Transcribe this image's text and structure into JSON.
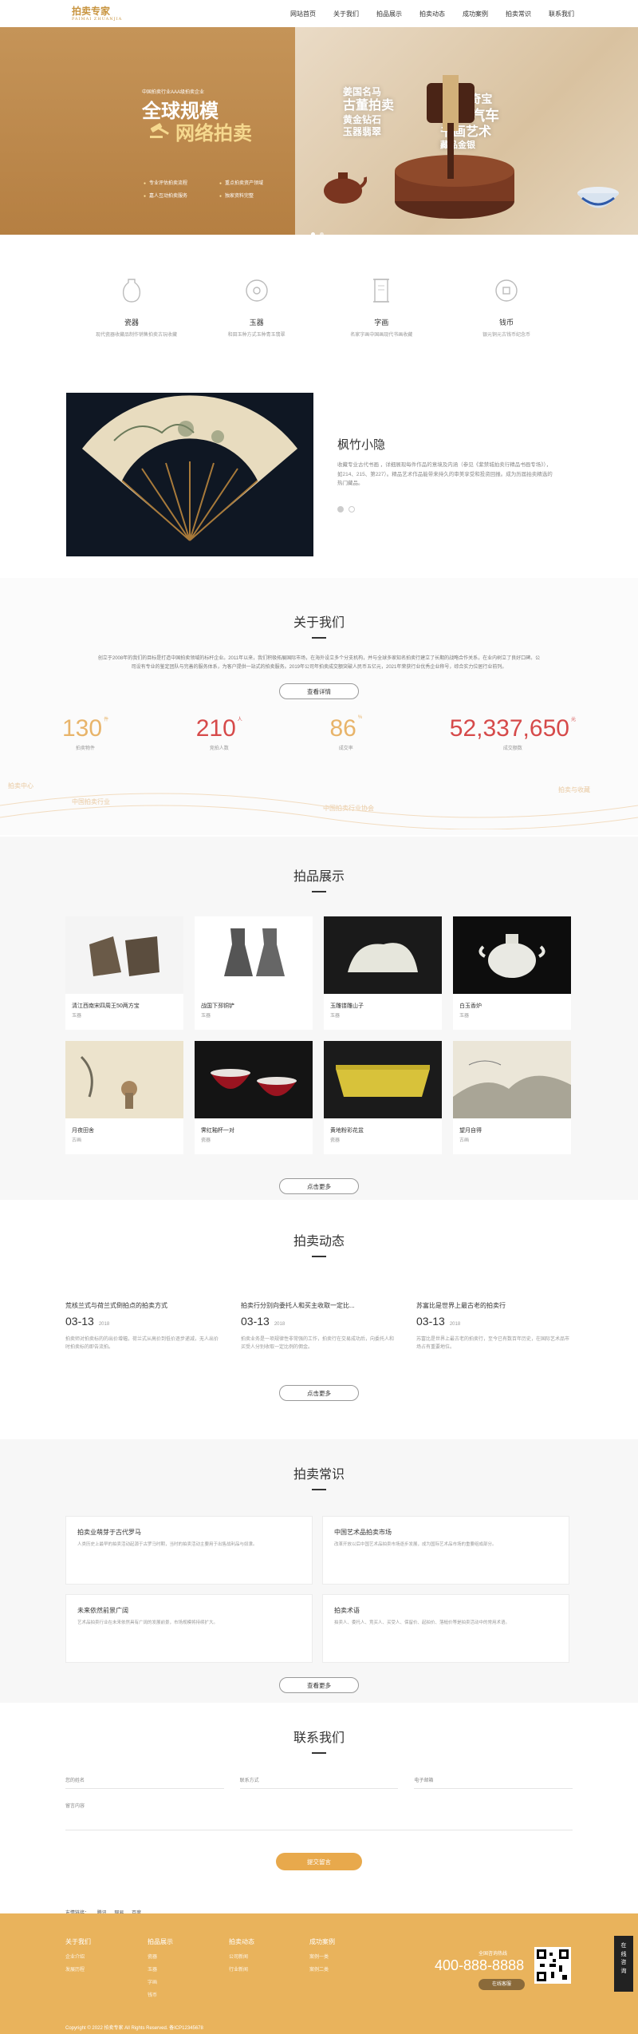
{
  "header": {
    "logo": "拍卖专家",
    "logo_sub": "PAIMAI ZHUANJIA",
    "nav": [
      "网站首页",
      "关于我们",
      "拍品展示",
      "拍卖动态",
      "成功案例",
      "拍卖常识",
      "联系我们"
    ]
  },
  "banner": {
    "subtitle": "中国拍卖行业AAA级拍卖企业",
    "title1": "全球规模",
    "title2": "网络拍卖",
    "features": [
      "专业评估拍卖流程",
      "重点拍卖资产领域",
      "嘉人互动拍卖服务",
      "独家资料完整",
      "拍卖热线电话"
    ],
    "promo_left": [
      "姜国名马",
      "古董拍卖",
      "黄金钻石",
      "玉器翡翠"
    ],
    "promo_right": [
      "100个奇宝",
      "50辆汽车",
      "书画艺术",
      "藏品金银"
    ]
  },
  "categories": [
    {
      "icon": "vase-icon",
      "title": "瓷器",
      "desc": "现代瓷器收藏品制作销售拍卖古玩收藏"
    },
    {
      "icon": "jade-disc-icon",
      "title": "玉器",
      "desc": "和田玉种方式玉种青玉翡翠"
    },
    {
      "icon": "scroll-icon",
      "title": "字画",
      "desc": "名家字画中国画现代书画收藏"
    },
    {
      "icon": "coin-icon",
      "title": "钱币",
      "desc": "银元铜元古钱币纪念币"
    }
  ],
  "feature": {
    "title": "枫竹小隐",
    "desc": "收藏专业古代书画 ，详细展现每件作品的意境及内涵（参见《紫禁城拍卖行精品书画专场》），如214、215、第227）。精品艺术作品能带来持久的审美享受和投资回报。成为历届拍卖精选的热门藏品。"
  },
  "about": {
    "title": "关于我们",
    "desc": "创立于2008年的我们的目标是打造中国拍卖领域的标杆企业。2011年以来，我们积极拓展国际市场，在海外设立多个分支机构，并与全球多家知名拍卖行建立了长期的战略合作关系，在业内树立了良好口碑。公司设有专业的鉴定团队与完善的服务体系，为客户提供一站式的拍卖服务。2019年公司年拍卖成交额突破人民币五亿元，2021年荣获行业优秀企业称号，综合实力位居行业前列。",
    "button": "查看详情",
    "stats": [
      {
        "value": "130",
        "unit": "件",
        "label": "拍卖物件",
        "color": "#e8b46a"
      },
      {
        "value": "210",
        "unit": "人",
        "label": "竞拍人数",
        "color": "#d64a4a"
      },
      {
        "value": "86",
        "unit": "%",
        "label": "成交率",
        "color": "#e8b46a"
      },
      {
        "value": "52,337,650",
        "unit": "元",
        "label": "成交额数",
        "color": "#d64a4a"
      }
    ],
    "watermarks": [
      "拍卖中心",
      "中国拍卖行业",
      "中国拍卖行业协会",
      "拍卖与收藏"
    ]
  },
  "products": {
    "title": "拍品展示",
    "items": [
      {
        "title": "清江西南宋四周王50两方宝",
        "cat": "玉器"
      },
      {
        "title": "战国下邳铜铲",
        "cat": "玉器"
      },
      {
        "title": "玉雕镂雕山子",
        "cat": "玉器"
      },
      {
        "title": "白玉香炉",
        "cat": "玉器"
      },
      {
        "title": "月夜田舍",
        "cat": "古画"
      },
      {
        "title": "霁红釉杯一对",
        "cat": "瓷器"
      },
      {
        "title": "黄地粉彩花盆",
        "cat": "瓷器"
      },
      {
        "title": "望月自得",
        "cat": "古画"
      }
    ],
    "button": "点击更多"
  },
  "news": {
    "title": "拍卖动态",
    "items": [
      {
        "title": "荒核兰式与荷兰式倒拍点的拍卖方式",
        "day": "03-13",
        "year": "2018",
        "summary": "拍卖师对拍卖标的的出价增幅，荷兰式从高价到低价逐步递减，无人出价时拍卖标的即告流拍。"
      },
      {
        "title": "拍卖行分别向委托人和买主收取一定比...",
        "day": "03-13",
        "year": "2018",
        "summary": "拍卖业务是一项规律性非常强的工作，拍卖行在交易成功后，向委托人和买受人分别收取一定比例的佣金。"
      },
      {
        "title": "苏富比是世界上最古老的拍卖行",
        "day": "03-13",
        "year": "2018",
        "summary": "苏富比是世界上最古老的拍卖行，至今已有数百年历史，在国际艺术品市场占有重要地位。"
      }
    ],
    "button": "点击更多"
  },
  "tips": {
    "title": "拍卖常识",
    "items": [
      {
        "title": "拍卖业萌芽于古代罗马",
        "summary": "人类历史上最早的拍卖活动起源于古罗马时期，当时的拍卖活动主要用于出售战利品与奴隶。"
      },
      {
        "title": "中国艺术品拍卖市场",
        "summary": "改革开放以后中国艺术品拍卖市场逐步发展，成为国际艺术品市场的重要组成部分。"
      },
      {
        "title": "未来依然前景广阔",
        "summary": "艺术品拍卖行业在未来依然具有广阔的发展前景，市场规模将持续扩大。"
      },
      {
        "title": "拍卖术语",
        "summary": "拍卖人、委托人、竞买人、买受人、保留价、起拍价、落槌价等是拍卖活动中的常用术语。"
      }
    ],
    "button": "查看更多"
  },
  "contact": {
    "title": "联系我们",
    "fields": [
      "您的姓名",
      "联系方式",
      "电子邮箱"
    ],
    "message": "留言内容",
    "submit": "提交留言",
    "links_label": "友情链接：",
    "links": [
      "腾讯",
      "网易",
      "百度"
    ]
  },
  "footer": {
    "cols": [
      {
        "h": "关于我们",
        "items": [
          "企业介绍",
          "发展历程"
        ]
      },
      {
        "h": "拍品展示",
        "items": [
          "瓷器",
          "玉器",
          "字画",
          "钱币"
        ]
      },
      {
        "h": "拍卖动态",
        "items": [
          "公司新闻",
          "行业新闻"
        ]
      },
      {
        "h": "成功案例",
        "items": [
          "案例一类",
          "案例二类"
        ]
      }
    ],
    "hotline_label": "全国咨询热线",
    "phone": "400-888-8888",
    "online": "在线客服",
    "copyright": "Copyright © 2022 拍卖专家 All Rights Reserved. 备ICP12345678",
    "float": "在线咨询"
  }
}
